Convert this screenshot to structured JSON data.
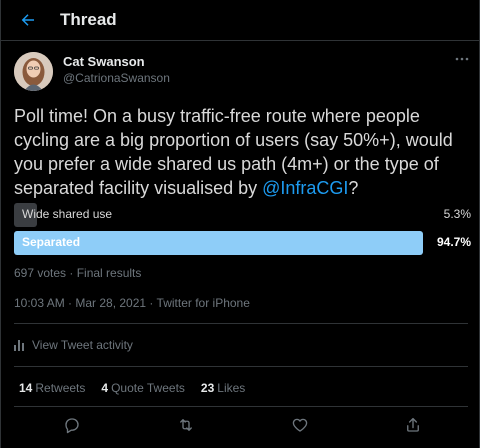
{
  "header": {
    "title": "Thread",
    "back_icon": "arrow-left-icon"
  },
  "author": {
    "name": "Cat Swanson",
    "handle": "@CatrionaSwanson"
  },
  "tweet": {
    "text_before": "Poll time! On a busy traffic-free route where people cycling are a big proportion of users (say 50%+), would you prefer a wide shared us path (4m+) or the type of separated facility visualised by ",
    "mention": "@InfraCGI",
    "text_after": "?"
  },
  "poll": {
    "options": [
      {
        "label": "Wide shared use",
        "percent_label": "5.3%",
        "fraction": 0.053
      },
      {
        "label": "Separated",
        "percent_label": "94.7%",
        "fraction": 0.947
      }
    ],
    "meta": "697 votes · Final results"
  },
  "timestamp": "10:03 AM · Mar 28, 2021 · Twitter for iPhone",
  "activity": {
    "label": "View Tweet activity"
  },
  "stats": {
    "retweets_count": "14",
    "retweets_label": "Retweets",
    "quotes_count": "4",
    "quotes_label": "Quote Tweets",
    "likes_count": "23",
    "likes_label": "Likes"
  },
  "colors": {
    "accent": "#1d9bf0",
    "poll_winner": "#8ecdf8",
    "poll_loser": "#3a3d41",
    "background": "#000000"
  }
}
